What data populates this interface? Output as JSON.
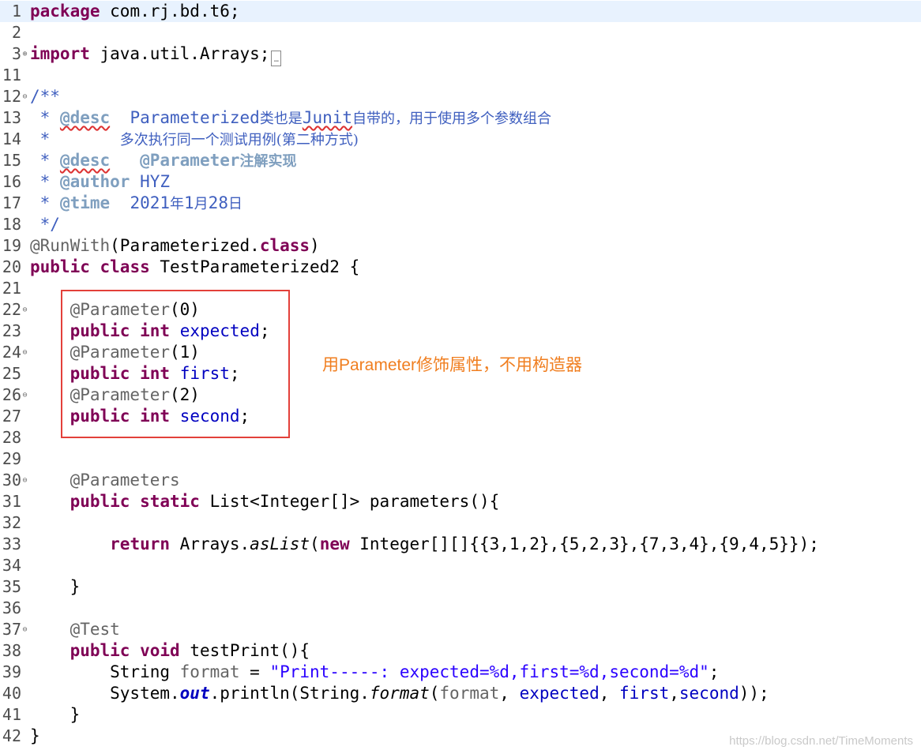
{
  "editor": {
    "lines": [
      {
        "n": "1",
        "segs": [
          {
            "t": "package",
            "c": "kw"
          },
          {
            "t": " com.rj.bd.t6;"
          }
        ],
        "current": true
      },
      {
        "n": "2",
        "segs": []
      },
      {
        "n": "3",
        "fold": "+",
        "segs": [
          {
            "t": "import",
            "c": "kw"
          },
          {
            "t": " java.util.Arrays;"
          },
          {
            "t": "…",
            "c": "boxed"
          }
        ]
      },
      {
        "n": "11",
        "segs": []
      },
      {
        "n": "12",
        "fold": "-",
        "segs": [
          {
            "t": "/**",
            "c": "cmt"
          }
        ]
      },
      {
        "n": "13",
        "segs": [
          {
            "t": " * ",
            "c": "cmt"
          },
          {
            "t": "@desc",
            "c": "tag sq"
          },
          {
            "t": "  Parameterized",
            "c": "cmt"
          },
          {
            "t": "类也是",
            "c": "cmt cjk"
          },
          {
            "t": "Junit",
            "c": "cmt sq"
          },
          {
            "t": "自带的，用于使用多个参数组合",
            "c": "cmt cjk"
          }
        ]
      },
      {
        "n": "14",
        "segs": [
          {
            "t": " *       ",
            "c": "cmt"
          },
          {
            "t": "多次执行同一个测试用例(第二种方式)",
            "c": "cmt cjk"
          }
        ]
      },
      {
        "n": "15",
        "segs": [
          {
            "t": " * ",
            "c": "cmt"
          },
          {
            "t": "@desc",
            "c": "tag sq"
          },
          {
            "t": "   ",
            "c": "cmt"
          },
          {
            "t": "@Parameter",
            "c": "tag"
          },
          {
            "t": "注解实现",
            "c": "tag cjk"
          }
        ]
      },
      {
        "n": "16",
        "segs": [
          {
            "t": " * ",
            "c": "cmt"
          },
          {
            "t": "@author",
            "c": "tag"
          },
          {
            "t": " HYZ",
            "c": "cmt"
          }
        ]
      },
      {
        "n": "17",
        "segs": [
          {
            "t": " * ",
            "c": "cmt"
          },
          {
            "t": "@time",
            "c": "tag"
          },
          {
            "t": "  2021",
            "c": "cmt"
          },
          {
            "t": "年",
            "c": "cmt cjk"
          },
          {
            "t": "1",
            "c": "cmt"
          },
          {
            "t": "月",
            "c": "cmt cjk"
          },
          {
            "t": "28",
            "c": "cmt"
          },
          {
            "t": "日",
            "c": "cmt cjk"
          }
        ]
      },
      {
        "n": "18",
        "segs": [
          {
            "t": " */",
            "c": "cmt"
          }
        ]
      },
      {
        "n": "19",
        "segs": [
          {
            "t": "@RunWith",
            "c": "ann"
          },
          {
            "t": "(Parameterized."
          },
          {
            "t": "class",
            "c": "kw"
          },
          {
            "t": ")"
          }
        ]
      },
      {
        "n": "20",
        "segs": [
          {
            "t": "public",
            "c": "kw"
          },
          {
            "t": " "
          },
          {
            "t": "class",
            "c": "kw"
          },
          {
            "t": " TestParameterized2 {"
          }
        ]
      },
      {
        "n": "21",
        "segs": []
      },
      {
        "n": "22",
        "fold": "-",
        "segs": [
          {
            "t": "    "
          },
          {
            "t": "@Parameter",
            "c": "ann"
          },
          {
            "t": "(0)"
          }
        ]
      },
      {
        "n": "23",
        "segs": [
          {
            "t": "    "
          },
          {
            "t": "public",
            "c": "kw"
          },
          {
            "t": " "
          },
          {
            "t": "int",
            "c": "kw"
          },
          {
            "t": " "
          },
          {
            "t": "expected",
            "c": "fld"
          },
          {
            "t": ";"
          }
        ]
      },
      {
        "n": "24",
        "fold": "-",
        "segs": [
          {
            "t": "    "
          },
          {
            "t": "@Parameter",
            "c": "ann"
          },
          {
            "t": "(1)"
          }
        ]
      },
      {
        "n": "25",
        "segs": [
          {
            "t": "    "
          },
          {
            "t": "public",
            "c": "kw"
          },
          {
            "t": " "
          },
          {
            "t": "int",
            "c": "kw"
          },
          {
            "t": " "
          },
          {
            "t": "first",
            "c": "fld"
          },
          {
            "t": ";"
          }
        ]
      },
      {
        "n": "26",
        "fold": "-",
        "segs": [
          {
            "t": "    "
          },
          {
            "t": "@Parameter",
            "c": "ann"
          },
          {
            "t": "(2)"
          }
        ]
      },
      {
        "n": "27",
        "segs": [
          {
            "t": "    "
          },
          {
            "t": "public",
            "c": "kw"
          },
          {
            "t": " "
          },
          {
            "t": "int",
            "c": "kw"
          },
          {
            "t": " "
          },
          {
            "t": "second",
            "c": "fld"
          },
          {
            "t": ";"
          }
        ]
      },
      {
        "n": "28",
        "segs": []
      },
      {
        "n": "29",
        "segs": []
      },
      {
        "n": "30",
        "fold": "-",
        "segs": [
          {
            "t": "    "
          },
          {
            "t": "@Parameters",
            "c": "ann"
          }
        ]
      },
      {
        "n": "31",
        "segs": [
          {
            "t": "    "
          },
          {
            "t": "public",
            "c": "kw"
          },
          {
            "t": " "
          },
          {
            "t": "static",
            "c": "kw"
          },
          {
            "t": " List<Integer[]> parameters(){"
          }
        ]
      },
      {
        "n": "32",
        "segs": []
      },
      {
        "n": "33",
        "segs": [
          {
            "t": "        "
          },
          {
            "t": "return",
            "c": "kw"
          },
          {
            "t": " Arrays."
          },
          {
            "t": "asList",
            "c": "ital"
          },
          {
            "t": "("
          },
          {
            "t": "new",
            "c": "kw"
          },
          {
            "t": " Integer[][]{{3,1,2},{5,2,3},{7,3,4},{9,4,5}});"
          }
        ]
      },
      {
        "n": "34",
        "segs": []
      },
      {
        "n": "35",
        "segs": [
          {
            "t": "    }"
          }
        ]
      },
      {
        "n": "36",
        "segs": []
      },
      {
        "n": "37",
        "fold": "-",
        "segs": [
          {
            "t": "    "
          },
          {
            "t": "@Test",
            "c": "ann"
          }
        ]
      },
      {
        "n": "38",
        "segs": [
          {
            "t": "    "
          },
          {
            "t": "public",
            "c": "kw"
          },
          {
            "t": " "
          },
          {
            "t": "void",
            "c": "kw"
          },
          {
            "t": " testPrint(){"
          }
        ]
      },
      {
        "n": "39",
        "segs": [
          {
            "t": "        String "
          },
          {
            "t": "format",
            "c": "ann"
          },
          {
            "t": " = "
          },
          {
            "t": "\"Print-----: expected=%d,first=%d,second=%d\"",
            "c": "str"
          },
          {
            "t": ";"
          }
        ]
      },
      {
        "n": "40",
        "segs": [
          {
            "t": "        System."
          },
          {
            "t": "out",
            "c": "stat"
          },
          {
            "t": ".println(String."
          },
          {
            "t": "format",
            "c": "ital"
          },
          {
            "t": "("
          },
          {
            "t": "format",
            "c": "ann"
          },
          {
            "t": ", "
          },
          {
            "t": "expected",
            "c": "fld"
          },
          {
            "t": ", "
          },
          {
            "t": "first",
            "c": "fld"
          },
          {
            "t": ","
          },
          {
            "t": "second",
            "c": "fld"
          },
          {
            "t": "));"
          }
        ]
      },
      {
        "n": "41",
        "segs": [
          {
            "t": "    }"
          }
        ]
      },
      {
        "n": "42",
        "segs": [
          {
            "t": "}"
          }
        ]
      }
    ]
  },
  "annotation": {
    "note": "用Parameter修饰属性，不用构造器",
    "box_color": "#e3403a",
    "note_color": "#f07e1f"
  },
  "watermark": "https://blog.csdn.net/TimeMoments",
  "colors": {
    "keyword": "#7f0055",
    "annotation": "#646464",
    "field": "#0000c0",
    "string": "#2a00ff",
    "javadoc": "#3f5fbf",
    "javadoc_tag": "#7f9fbf",
    "current_line": "#e8f2fe"
  }
}
